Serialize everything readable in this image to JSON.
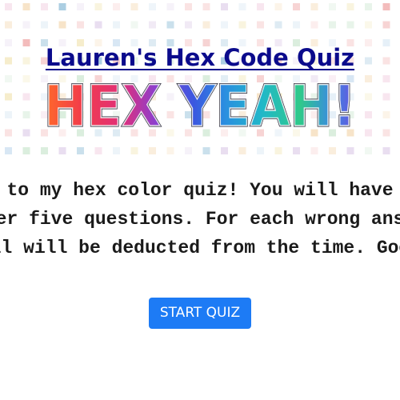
{
  "header": {
    "title": "Lauren's Hex Code Quiz",
    "logo_text": "HEX YEAH!",
    "background_pattern": "pastel-colored-squares-grid"
  },
  "intro": {
    "lines": [
      "to my hex color quiz! You will have",
      "er five questions. For each wrong ans",
      "ll will be deducted from the time. Goo"
    ]
  },
  "start_button": {
    "label": "START QUIZ",
    "color": "#1d7bf5"
  },
  "colors": {
    "title": "#0b0b8c",
    "button": "#1d7bf5",
    "text": "#1a1a1a"
  }
}
